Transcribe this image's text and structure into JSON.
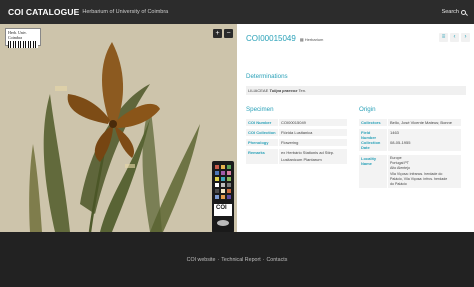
{
  "header": {
    "brand": "COI CATALOGUE",
    "subtitle": "Herbarium of University of Coimbra",
    "search_label": "Search"
  },
  "viewer": {
    "label_text": "Herb. Univ. Coimbra",
    "zoom_in": "+",
    "zoom_out": "−",
    "chart_label": "COI"
  },
  "record": {
    "id": "COI00015049",
    "tag": "▦ Herbarium",
    "nav": [
      "≡",
      "‹",
      "›"
    ]
  },
  "determinations": {
    "heading": "Determinations",
    "text_prefix": "LILIACEAE ",
    "text_name": "Tulipa praecox",
    "text_suffix": " Ten."
  },
  "specimen": {
    "heading": "Specimen",
    "rows": [
      {
        "k": "COI Number",
        "v": "COI00015049"
      },
      {
        "k": "COI Collection",
        "v": "Flórida Lusitanica"
      },
      {
        "k": "Phenology",
        "v": "Flowering"
      },
      {
        "k": "Remarks",
        "v": "ex Herbário Stationis ad Stirp. Lusitanicum Plantarum"
      }
    ]
  },
  "origin": {
    "heading": "Origin",
    "rows": [
      {
        "k": "Collectors",
        "v": "Bello, José Vicente Mateus; Bonne"
      },
      {
        "k": "Field Number",
        "v": "1463"
      },
      {
        "k": "Collection Date",
        "v": "08-05-1955"
      },
      {
        "k": "Locality Name",
        "v": "Europe\nPortugal PT\nAlto Alentejo\nVila Viçosa: infrancs. herdade do\nPalácio, Vila Viçosa: infrcs. herdade\ndo Palácio"
      }
    ]
  },
  "footer": {
    "website": "COI website",
    "sep1": "·",
    "report": "Technical Report",
    "sep2": "·",
    "contacts": "Contacts"
  },
  "colors": {
    "accent": "#2aa1b8",
    "topbar": "#2c2c2c",
    "footer": "#222222",
    "paper": "#c9c0a8"
  }
}
